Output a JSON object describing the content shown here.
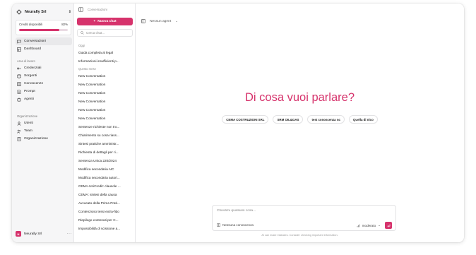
{
  "colors": {
    "accent": "#d6336c",
    "sidebar_bg": "#f6f6f7"
  },
  "sidebar": {
    "org_name": "Neurally Srl",
    "credits": {
      "label": "Crediti disponibili",
      "percent_label": "82%",
      "percent": 82
    },
    "nav_top": [
      {
        "label": "Conversazioni",
        "icon": "chat-icon",
        "active": true
      },
      {
        "label": "Dashboard",
        "icon": "dashboard-icon"
      }
    ],
    "workspace_title": "Area di lavoro",
    "workspace_items": [
      {
        "label": "Credenziali",
        "icon": "key-icon"
      },
      {
        "label": "Sorgenti",
        "icon": "database-icon"
      },
      {
        "label": "Conoscenze",
        "icon": "book-icon"
      },
      {
        "label": "Prompt",
        "icon": "document-icon"
      },
      {
        "label": "Agenti",
        "icon": "bot-icon"
      }
    ],
    "org_title": "Organizzazione",
    "org_items": [
      {
        "label": "Utenti",
        "icon": "user-icon"
      },
      {
        "label": "Team",
        "icon": "team-icon"
      },
      {
        "label": "Organizzazione",
        "icon": "building-icon"
      }
    ],
    "footer_user": "Neurally Srl"
  },
  "conversations": {
    "breadcrumb": "Conversazioni",
    "new_chat_label": "Nuova chat",
    "search_placeholder": "Cerca chat...",
    "groups": [
      {
        "title": "Oggi",
        "items": [
          "Guida completa al legal",
          "Informazioni insufficienti p..."
        ]
      },
      {
        "title": "Questo mese",
        "items": [
          "New Conversation",
          "New Conversation",
          "New Conversation",
          "New Conversation",
          "New Conversation",
          "New Conversation",
          "Sentenze richieste non tro...",
          "Chiarimento su cosa riass...",
          "Sintesi pratiche amministr...",
          "Richiesta di dettagli per ri...",
          "Sentenza Unica 220/2024",
          "Modifica secondaria AIC",
          "Modifica secondaria autori...",
          "CEMA-UniCredit: clausole ...",
          "CEMA: sintesi della causa",
          "Avvocato della Prima Prati...",
          "Contenzioso tessi extra-fido",
          "Riepilogo contenuti per C...",
          "Impossibilità di scissione a..."
        ]
      }
    ]
  },
  "main": {
    "agent_selector": "Nessun agent",
    "headline": "Di cosa vuoi parlare?",
    "chips": [
      "CEMA COSTRUZIONI SRL",
      "SRM OIL&GAS",
      "test conoscenza nc",
      "Quella di nico"
    ],
    "composer_placeholder": "Chiedimi qualsiasi cosa...",
    "knowledge_label": "Nessuna conoscenza",
    "mode_label": "moderato",
    "disclaimer": "AI can make mistakes. Consider checking important information."
  }
}
